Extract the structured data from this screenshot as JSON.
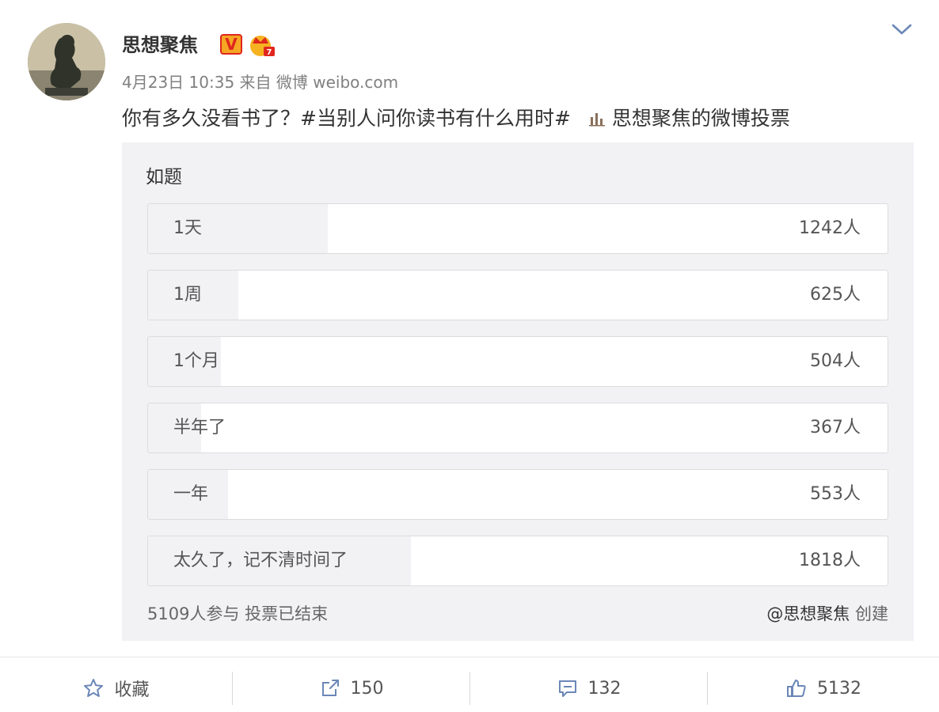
{
  "post": {
    "username": "思想聚焦",
    "verified_badge": "V",
    "timestamp": "4月23日 10:35",
    "source_prefix": "来自",
    "source": "微博 weibo.com",
    "text": "你有多久没看书了？",
    "topic": "#当别人问你读书有什么用时#",
    "vote_link": "思想聚焦的微博投票"
  },
  "vote": {
    "title": "如题",
    "options": [
      {
        "label": "1天",
        "count": "1242人",
        "votes": 1242
      },
      {
        "label": "1周",
        "count": "625人",
        "votes": 625
      },
      {
        "label": "1个月",
        "count": "504人",
        "votes": 504
      },
      {
        "label": "半年了",
        "count": "367人",
        "votes": 367
      },
      {
        "label": "一年",
        "count": "553人",
        "votes": 553
      },
      {
        "label": "太久了，记不清时间了",
        "count": "1818人",
        "votes": 1818
      }
    ],
    "summary": "5109人参与 投票已结束",
    "creator": "@思想聚焦",
    "creator_suffix": "创建"
  },
  "actions": {
    "favorite": "收藏",
    "repost": "150",
    "comment": "132",
    "like": "5132"
  },
  "colors": {
    "card_bg": "#f2f2f5",
    "option_bg": "#ffffff",
    "text": "#333333",
    "muted": "#808080",
    "icon": "#6b87b8"
  },
  "icons": {
    "collapse": "chevron-down-icon",
    "favorite": "star-icon",
    "repost": "repost-icon",
    "comment": "comment-icon",
    "like": "thumbs-up-icon"
  }
}
